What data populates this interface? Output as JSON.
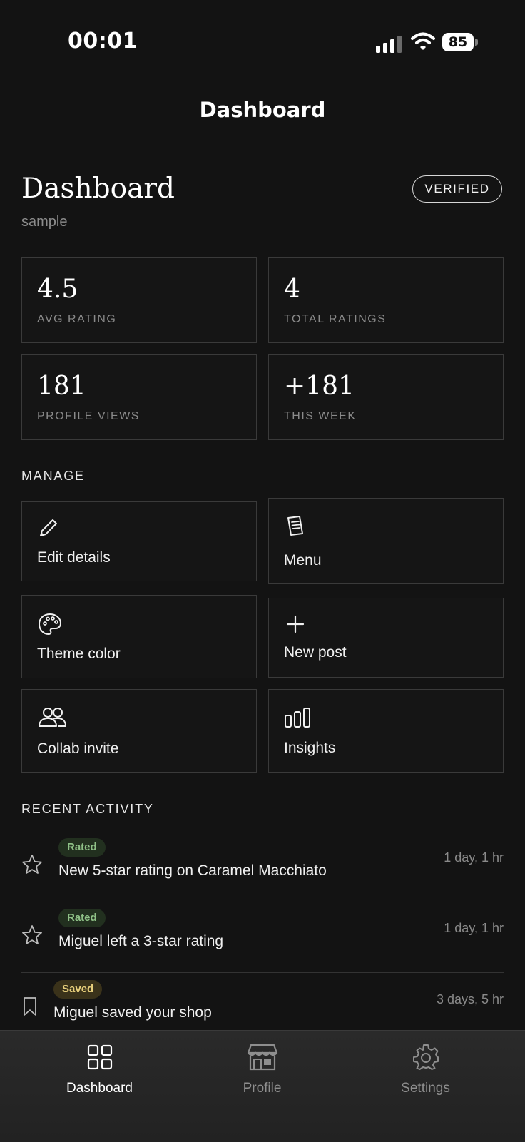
{
  "status_bar": {
    "time": "00:01",
    "battery": "85"
  },
  "header": {
    "nav_title": "Dashboard",
    "title": "Dashboard",
    "subtitle": "sample",
    "badge": "VERIFIED"
  },
  "stats": [
    {
      "value": "4.5",
      "label": "AVG RATING"
    },
    {
      "value": "4",
      "label": "TOTAL RATINGS"
    },
    {
      "value": "181",
      "label": "PROFILE VIEWS"
    },
    {
      "value": "+181",
      "label": "THIS WEEK"
    }
  ],
  "manage": {
    "title": "MANAGE",
    "items": [
      {
        "label": "Edit details",
        "icon": "pencil-icon"
      },
      {
        "label": "Menu",
        "icon": "menu-book-icon"
      },
      {
        "label": "Theme color",
        "icon": "palette-icon"
      },
      {
        "label": "New post",
        "icon": "plus-icon"
      },
      {
        "label": "Collab invite",
        "icon": "people-icon"
      },
      {
        "label": "Insights",
        "icon": "bar-chart-icon"
      }
    ]
  },
  "activity": {
    "title": "RECENT ACTIVITY",
    "items": [
      {
        "badge": "Rated",
        "text": "New 5-star rating on Caramel Macchiato",
        "time": "1 day, 1 hr",
        "icon": "star-icon"
      },
      {
        "badge": "Rated",
        "text": "Miguel left a 3-star rating",
        "time": "1 day, 1 hr",
        "icon": "star-icon"
      },
      {
        "badge": "Saved",
        "text": "Miguel saved your shop",
        "time": "3 days, 5 hr",
        "icon": "bookmark-icon"
      }
    ]
  },
  "tabs": [
    {
      "label": "Dashboard",
      "icon": "grid-icon",
      "active": true
    },
    {
      "label": "Profile",
      "icon": "storefront-icon",
      "active": false
    },
    {
      "label": "Settings",
      "icon": "gear-icon",
      "active": false
    }
  ],
  "colors": {
    "background": "#131313",
    "card_border": "#3a3a3a",
    "rated_badge": "#8fc187",
    "saved_badge": "#e8cf7c"
  }
}
